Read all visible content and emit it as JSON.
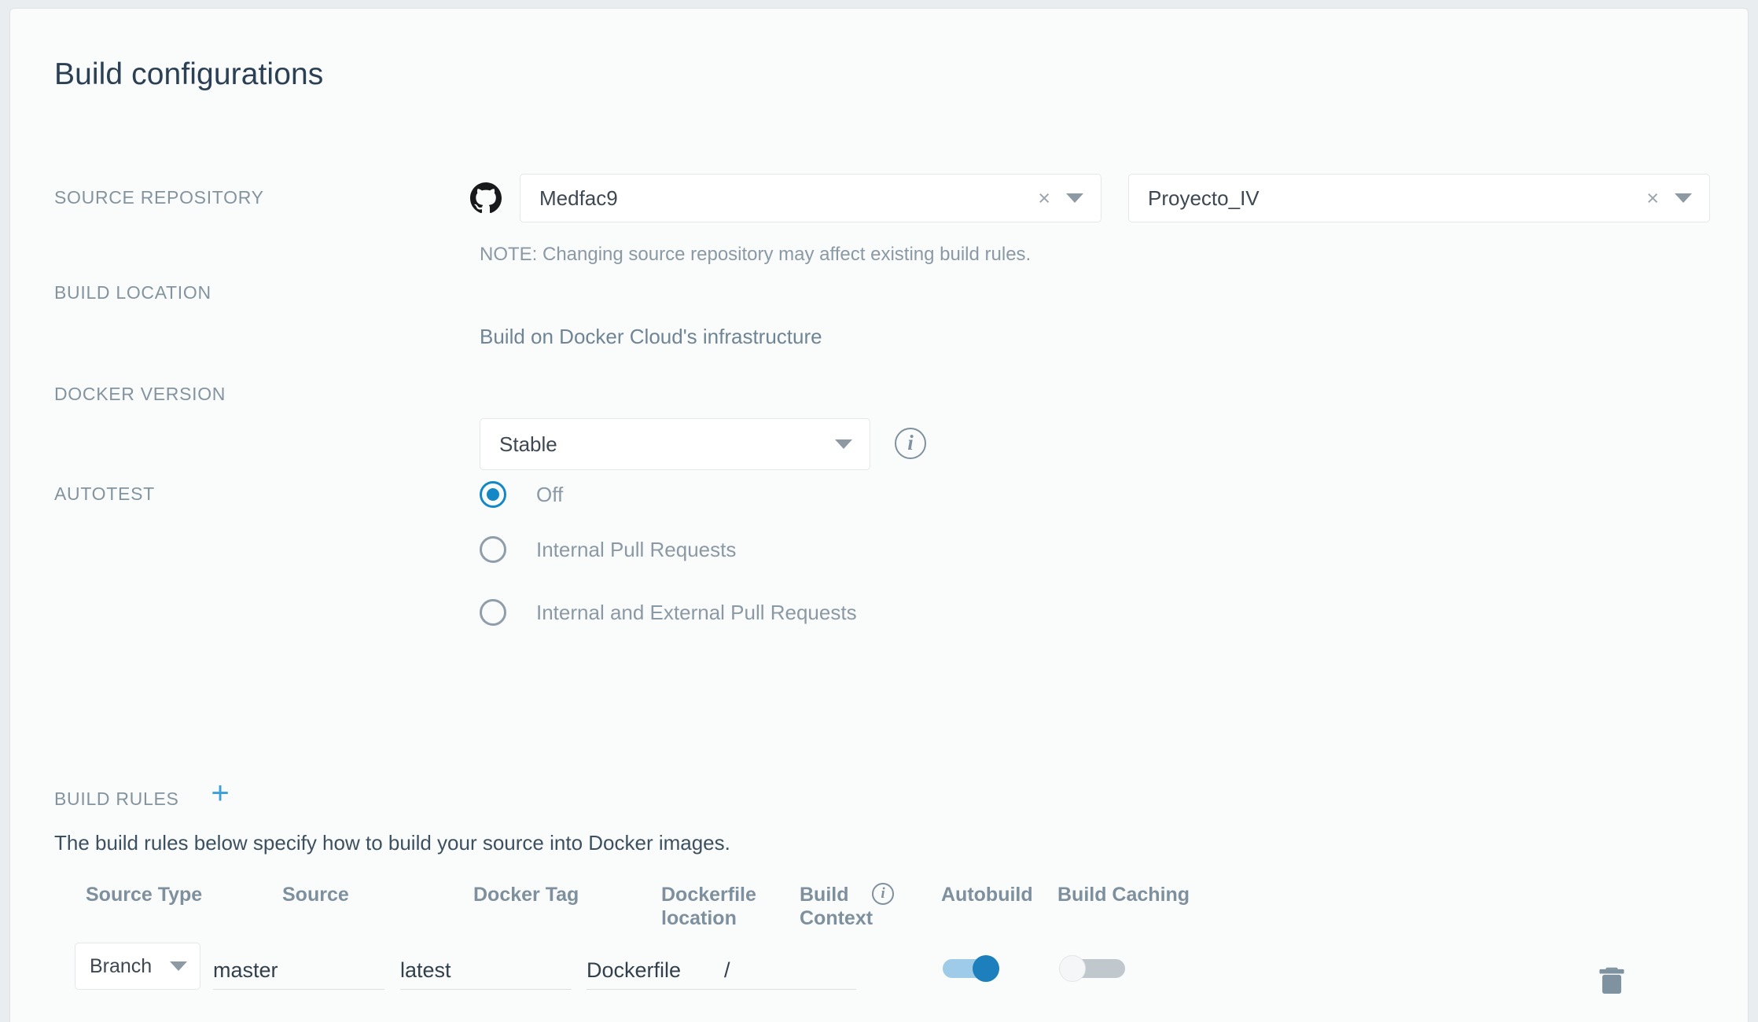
{
  "page": {
    "title": "Build configurations"
  },
  "sections": {
    "source_repository": {
      "label": "SOURCE REPOSITORY",
      "vcs_icon": "github-icon",
      "owner_value": "Medfac9",
      "repo_value": "Proyecto_IV",
      "clear_glyph": "×",
      "note": "NOTE: Changing source repository may affect existing build rules."
    },
    "build_location": {
      "label": "BUILD LOCATION",
      "value": "Build on Docker Cloud's infrastructure"
    },
    "docker_version": {
      "label": "DOCKER VERSION",
      "value": "Stable",
      "info_icon": "info-icon",
      "info_glyph": "i"
    },
    "autotest": {
      "label": "AUTOTEST",
      "options": [
        {
          "label": "Off",
          "selected": true
        },
        {
          "label": "Internal Pull Requests",
          "selected": false
        },
        {
          "label": "Internal and External Pull Requests",
          "selected": false
        }
      ]
    },
    "build_rules": {
      "label": "BUILD RULES",
      "add_glyph": "+",
      "description": "The build rules below specify how to build your source into Docker images.",
      "columns": {
        "source_type": "Source Type",
        "source": "Source",
        "docker_tag": "Docker Tag",
        "dockerfile_location_line1": "Dockerfile",
        "dockerfile_location_line2": "location",
        "build_context_line1": "Build",
        "build_context_line2": "Context",
        "build_context_info_glyph": "i",
        "autobuild": "Autobuild",
        "build_caching": "Build Caching"
      },
      "rows": [
        {
          "source_type": "Branch",
          "source": "master",
          "docker_tag": "latest",
          "dockerfile_location": "Dockerfile",
          "build_context": "/",
          "autobuild": true,
          "build_caching": false,
          "delete_icon": "trash-icon"
        }
      ]
    }
  },
  "colors": {
    "accent_blue": "#1488c6",
    "add_blue": "#3b9fd8",
    "title_ink": "#2c4055",
    "label_gray": "#83949f",
    "page_bg": "#e9edf0",
    "card_bg": "#fafbfb",
    "toggle_on": "#1d80bc",
    "toggle_off": "#c0c8ce"
  }
}
